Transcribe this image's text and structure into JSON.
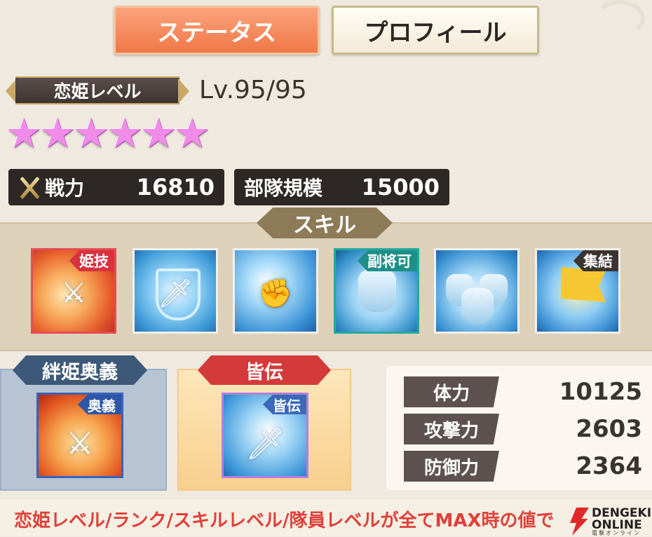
{
  "tabs": {
    "status": "ステータス",
    "profile": "プロフィール"
  },
  "level": {
    "badge": "恋姫レベル",
    "value": "Lv.95/95"
  },
  "rank": {
    "stars": 6,
    "star_color": "#f08ce8"
  },
  "stats_top": {
    "power_label": "戦力",
    "power_value": "16810",
    "troop_label": "部隊規模",
    "troop_value": "15000"
  },
  "skills": {
    "title": "スキル",
    "items": [
      {
        "tag": "姫技",
        "icon": "sword-slash-icon"
      },
      {
        "tag": "",
        "icon": "shield-sword-icon"
      },
      {
        "tag": "",
        "icon": "armored-arm-icon"
      },
      {
        "tag": "副将可",
        "icon": "armor-icon"
      },
      {
        "tag": "",
        "icon": "triple-armor-icon"
      },
      {
        "tag": "集結",
        "icon": "flag-icon"
      }
    ]
  },
  "kizuna": {
    "title": "絆姫奥義",
    "tag": "奥義",
    "icon": "group-warriors-icon"
  },
  "minaden": {
    "title": "皆伝",
    "tag": "皆伝",
    "icon": "triple-sword-icon"
  },
  "stats": [
    {
      "label": "体力",
      "value": "10125"
    },
    {
      "label": "攻撃力",
      "value": "2603"
    },
    {
      "label": "防御力",
      "value": "2364"
    }
  ],
  "footer": {
    "note": "恋姫レベル/ランク/スキルレベル/隊員レベルが全てMAX時の値で"
  },
  "watermark": {
    "line1": "DENGEKI",
    "line2": "ONLINE",
    "line3": "電撃オンライン"
  },
  "colors": {
    "accent": "#f07848",
    "note": "#e0403a",
    "plate": "#2d2826"
  }
}
